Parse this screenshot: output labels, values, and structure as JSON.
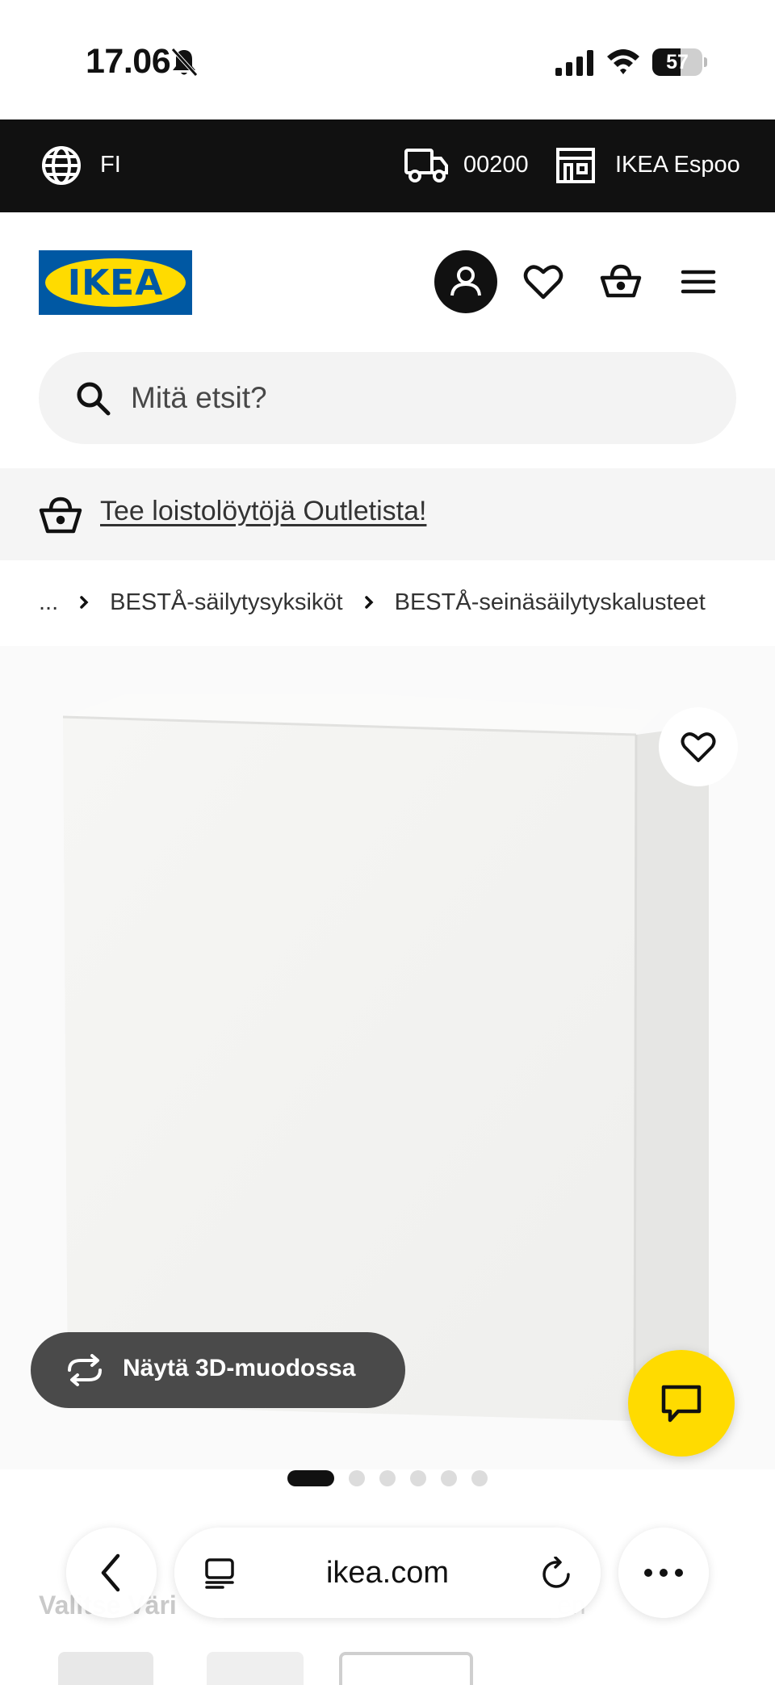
{
  "status_bar": {
    "time": "17.06",
    "battery": "57",
    "battery_level": 0.57
  },
  "topbar": {
    "language": "FI",
    "postal_code": "00200",
    "store": "IKEA Espoo"
  },
  "header": {
    "logo_text": "IKEA",
    "brand_colors": {
      "blue": "#0058a3",
      "yellow": "#ffdb00"
    }
  },
  "search": {
    "placeholder": "Mitä etsit?"
  },
  "outlet_banner": {
    "link_text": "Tee loistolöytöjä Outletista!"
  },
  "breadcrumb": {
    "ellipsis": "...",
    "items": [
      "BESTÅ-säilytysyksiköt",
      "BESTÅ-seinäsäilytyskalusteet"
    ]
  },
  "gallery": {
    "view_3d_label": "Näytä 3D-muodossa",
    "image_count": 6,
    "active_index": 0
  },
  "below_fold": {
    "left_text": "Valitse Väri",
    "right_text": "en"
  },
  "browser": {
    "url": "ikea.com"
  },
  "icons": {
    "language": "globe-icon",
    "delivery": "truck-icon",
    "store": "store-icon",
    "account": "account-icon",
    "favourites": "heart-icon",
    "cart": "basket-icon",
    "menu": "hamburger-icon",
    "search": "search-icon",
    "chat": "chat-icon"
  },
  "colors": {
    "topbar_bg": "#111111",
    "chat_button": "#ffdb00",
    "view_3d_button": "#4a4a4a"
  }
}
